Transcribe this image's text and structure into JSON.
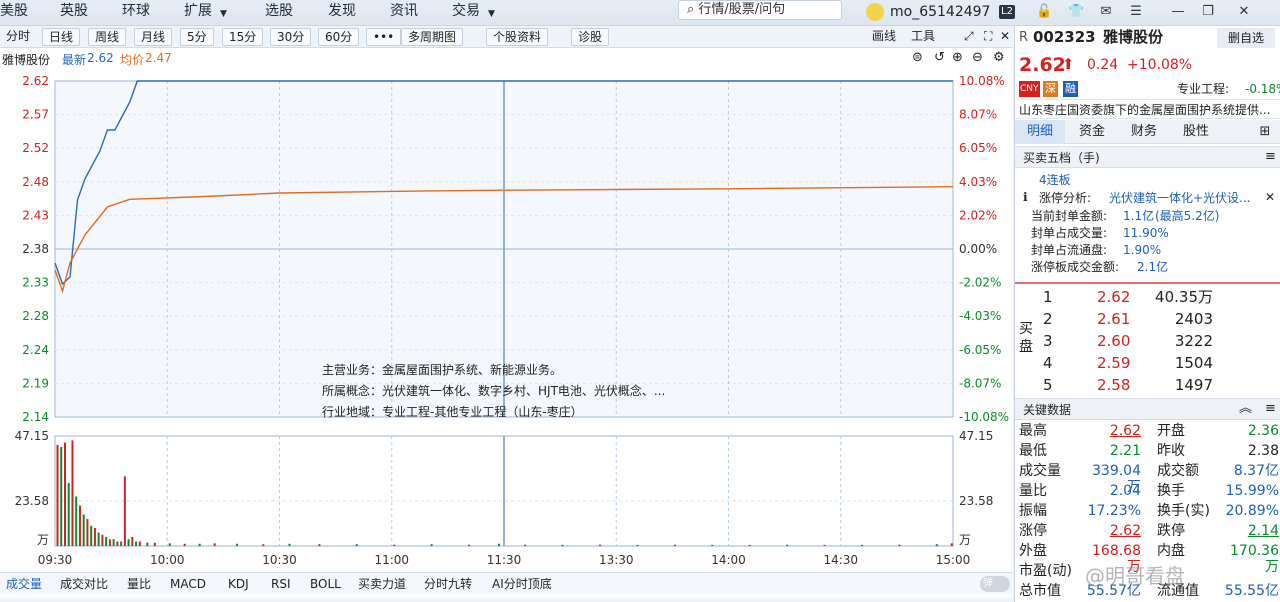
{
  "nav": [
    "美股",
    "英股",
    "环球",
    "扩展",
    "选股",
    "发现",
    "资讯",
    "交易"
  ],
  "search_placeholder": "行情/股票/问句",
  "user": "mo_65142497",
  "user_badge": "L2",
  "toolbar": {
    "tabs": [
      "分时",
      "日线",
      "周线",
      "月线",
      "5分",
      "15分",
      "30分",
      "60分",
      "•••",
      "多周期图",
      "个股资料",
      "诊股"
    ],
    "right": [
      "画线",
      "工具",
      "⤢",
      "⛶",
      "✕"
    ]
  },
  "info": {
    "name": "雅博股份",
    "latest_label": "最新",
    "latest": "2.62",
    "avg_label": "均价",
    "avg": "2.47"
  },
  "chart_data": {
    "type": "line",
    "y_left_ticks": [
      "2.62",
      "2.57",
      "2.52",
      "2.48",
      "2.43",
      "2.38",
      "2.33",
      "2.28",
      "2.24",
      "2.19",
      "2.14"
    ],
    "y_right_ticks": [
      "10.08%",
      "8.07%",
      "6.05%",
      "4.03%",
      "2.02%",
      "0.00%",
      "-2.02%",
      "-4.03%",
      "-6.05%",
      "-8.07%",
      "-10.08%"
    ],
    "ylim": [
      2.14,
      2.62
    ],
    "x_ticks": [
      "09:30",
      "10:00",
      "10:30",
      "11:00",
      "11:30",
      "13:30",
      "14:00",
      "14:30",
      "15:00"
    ],
    "series": [
      {
        "name": "最新",
        "color": "#2e68b8",
        "points": [
          [
            0,
            2.36
          ],
          [
            2,
            2.33
          ],
          [
            4,
            2.34
          ],
          [
            6,
            2.45
          ],
          [
            8,
            2.48
          ],
          [
            10,
            2.5
          ],
          [
            12,
            2.52
          ],
          [
            14,
            2.55
          ],
          [
            16,
            2.55
          ],
          [
            18,
            2.57
          ],
          [
            20,
            2.59
          ],
          [
            22,
            2.62
          ],
          [
            240,
            2.62
          ]
        ]
      },
      {
        "name": "均价",
        "color": "#e06d1f",
        "points": [
          [
            0,
            2.35
          ],
          [
            2,
            2.32
          ],
          [
            4,
            2.36
          ],
          [
            8,
            2.4
          ],
          [
            14,
            2.44
          ],
          [
            20,
            2.451
          ],
          [
            40,
            2.455
          ],
          [
            60,
            2.46
          ],
          [
            100,
            2.463
          ],
          [
            120,
            2.464
          ],
          [
            180,
            2.466
          ],
          [
            240,
            2.469
          ]
        ]
      }
    ],
    "volume": {
      "ticks": [
        "47.15",
        "23.58",
        "万"
      ],
      "max": 47.15,
      "bars": [
        [
          0,
          45,
          "r"
        ],
        [
          1,
          44,
          "g"
        ],
        [
          2,
          46,
          "r"
        ],
        [
          3,
          28,
          "g"
        ],
        [
          4,
          47,
          "r"
        ],
        [
          5,
          22,
          "g"
        ],
        [
          6,
          18,
          "r"
        ],
        [
          7,
          14,
          "g"
        ],
        [
          8,
          12,
          "r"
        ],
        [
          9,
          9,
          "g"
        ],
        [
          10,
          8,
          "r"
        ],
        [
          11,
          6,
          "g"
        ],
        [
          12,
          5,
          "r"
        ],
        [
          13,
          4,
          "g"
        ],
        [
          14,
          3,
          "r"
        ],
        [
          15,
          3,
          "g"
        ],
        [
          16,
          2,
          "r"
        ],
        [
          17,
          2,
          "g"
        ],
        [
          18,
          31,
          "r"
        ],
        [
          19,
          3,
          "g"
        ],
        [
          20,
          4,
          "r"
        ],
        [
          21,
          2,
          "g"
        ],
        [
          22,
          2,
          "r"
        ],
        [
          24,
          1.5,
          "g"
        ],
        [
          26,
          1.5,
          "r"
        ],
        [
          30,
          1.2,
          "g"
        ],
        [
          34,
          1,
          "r"
        ],
        [
          38,
          1,
          "g"
        ],
        [
          42,
          1.2,
          "r"
        ],
        [
          48,
          1,
          "g"
        ],
        [
          55,
          0.8,
          "r"
        ],
        [
          62,
          1,
          "g"
        ],
        [
          70,
          0.8,
          "r"
        ],
        [
          80,
          0.8,
          "g"
        ],
        [
          90,
          0.6,
          "r"
        ],
        [
          100,
          0.8,
          "g"
        ],
        [
          110,
          0.6,
          "r"
        ],
        [
          118,
          1,
          "g"
        ],
        [
          125,
          0.6,
          "r"
        ],
        [
          135,
          0.5,
          "g"
        ],
        [
          145,
          0.6,
          "r"
        ],
        [
          155,
          0.5,
          "g"
        ],
        [
          165,
          0.6,
          "r"
        ],
        [
          175,
          0.5,
          "g"
        ],
        [
          185,
          0.5,
          "r"
        ],
        [
          195,
          0.6,
          "g"
        ],
        [
          205,
          0.5,
          "r"
        ],
        [
          215,
          0.5,
          "g"
        ],
        [
          225,
          0.6,
          "r"
        ],
        [
          235,
          0.8,
          "g"
        ],
        [
          239,
          1.2,
          "r"
        ]
      ]
    }
  },
  "annotation": [
    {
      "k": "主营业务：",
      "v": "金属屋面围护系统、新能源业务。"
    },
    {
      "k": "所属概念：",
      "v": "光伏建筑一体化、数字乡村、HJT电池、光伏概念、..."
    },
    {
      "k": "行业地域：",
      "v": "专业工程-其他专业工程（山东-枣庄）"
    }
  ],
  "bottom_tabs": [
    "成交量",
    "成交对比",
    "量比",
    "MACD",
    "KDJ",
    "RSI",
    "BOLL",
    "买卖力道",
    "分时九转",
    "AI分时顶底"
  ],
  "bottom_toggle": "弹",
  "quote": {
    "prefix": "R",
    "code": "002323",
    "name": "雅博股份",
    "delete_btn": "删自选",
    "price": "2.62",
    "arrow": "⬆",
    "change": "0.24",
    "pct": "+10.08%",
    "badges": [
      "CNY",
      "深",
      "融"
    ],
    "industry_label": "专业工程:",
    "industry_pct": "-0.18%",
    "desc": "山东枣庄国资委旗下的金属屋面围护系统提供..."
  },
  "rtabs": [
    "明细",
    "资金",
    "财务",
    "股性"
  ],
  "book": {
    "title": "买卖五档（手)",
    "streak": "4连板",
    "zt_label": "涨停分析:",
    "zt_value": "光伏建筑一体化+光伏设...",
    "stats": [
      {
        "k": "当前封单金额:",
        "v": "1.1亿",
        "extra": "(最高5.2亿)"
      },
      {
        "k": "封单占成交量:",
        "v": "11.90%",
        "extra": ""
      },
      {
        "k": "封单占流通盘:",
        "v": "1.90%",
        "extra": ""
      },
      {
        "k": "涨停板成交金额:",
        "v": "2.1亿",
        "extra": ""
      }
    ],
    "side_label": "买盘",
    "bids": [
      {
        "n": "1",
        "p": "2.62",
        "v": "40.35万"
      },
      {
        "n": "2",
        "p": "2.61",
        "v": "2403"
      },
      {
        "n": "3",
        "p": "2.60",
        "v": "3222"
      },
      {
        "n": "4",
        "p": "2.59",
        "v": "1504"
      },
      {
        "n": "5",
        "p": "2.58",
        "v": "1497"
      }
    ]
  },
  "key": {
    "title": "关键数据",
    "rows": [
      [
        {
          "k": "最高",
          "v": "2.62",
          "c": "red",
          "u": true
        },
        {
          "k": "开盘",
          "v": "2.36",
          "c": "green"
        }
      ],
      [
        {
          "k": "最低",
          "v": "2.21",
          "c": "green"
        },
        {
          "k": "昨收",
          "v": "2.38",
          "c": "dark"
        }
      ],
      [
        {
          "k": "成交量",
          "v": "339.04万",
          "c": "blue"
        },
        {
          "k": "成交额",
          "v": "8.37亿",
          "c": "blue"
        }
      ],
      [
        {
          "k": "量比",
          "v": "2.04",
          "c": "blue"
        },
        {
          "k": "换手",
          "v": "15.99%",
          "c": "blue"
        }
      ],
      [
        {
          "k": "振幅",
          "v": "17.23%",
          "c": "blue"
        },
        {
          "k": "换手(实)",
          "v": "20.89%",
          "c": "blue"
        }
      ],
      [
        {
          "k": "涨停",
          "v": "2.62",
          "c": "red",
          "u": true
        },
        {
          "k": "跌停",
          "v": "2.14",
          "c": "green",
          "u": true
        }
      ],
      [
        {
          "k": "外盘",
          "v": "168.68万",
          "c": "red"
        },
        {
          "k": "内盘",
          "v": "170.36万",
          "c": "green"
        }
      ],
      [
        {
          "k": "市盈(动)",
          "v": "",
          "c": "blue"
        },
        {
          "k": "",
          "v": "",
          "c": "blue"
        }
      ],
      [
        {
          "k": "总市值",
          "v": "55.57亿",
          "c": "blue"
        },
        {
          "k": "流通值",
          "v": "55.55亿",
          "c": "blue"
        }
      ]
    ]
  },
  "watermark": "@明哥看盘"
}
